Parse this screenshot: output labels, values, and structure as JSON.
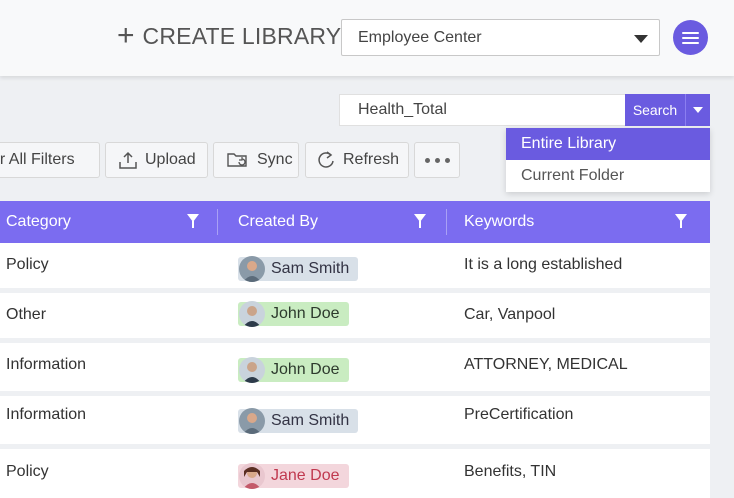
{
  "header": {
    "create_library_label": "CREATE LIBRARY",
    "library_select_value": "Employee Center"
  },
  "search": {
    "value": "Health_Total",
    "button_label": "Search",
    "scope_options": [
      "Entire Library",
      "Current Folder"
    ],
    "selected_scope": "Entire Library"
  },
  "toolbar": {
    "clear_filters_label": "ar All Filters",
    "upload_label": "Upload",
    "sync_label": "Sync",
    "refresh_label": "Refresh"
  },
  "grid": {
    "columns": [
      "Category",
      "Created By",
      "Keywords"
    ],
    "rows": [
      {
        "category": "Policy",
        "created_by": "Sam Smith",
        "keywords": "It is a long established"
      },
      {
        "category": "Other",
        "created_by": "John Doe",
        "keywords": "Car, Vanpool"
      },
      {
        "category": "Information",
        "created_by": "John Doe",
        "keywords": "ATTORNEY, MEDICAL"
      },
      {
        "category": "Information",
        "created_by": "Sam Smith",
        "keywords": "PreCertification"
      },
      {
        "category": "Policy",
        "created_by": "Jane Doe",
        "keywords": "Benefits, TIN"
      }
    ]
  },
  "colors": {
    "accent": "#6a5be0",
    "header_row": "#7b6cf0",
    "sam_chip": "#d8e0e8",
    "john_chip": "#c9ecc1",
    "jane_chip": "#f3d6dc"
  }
}
